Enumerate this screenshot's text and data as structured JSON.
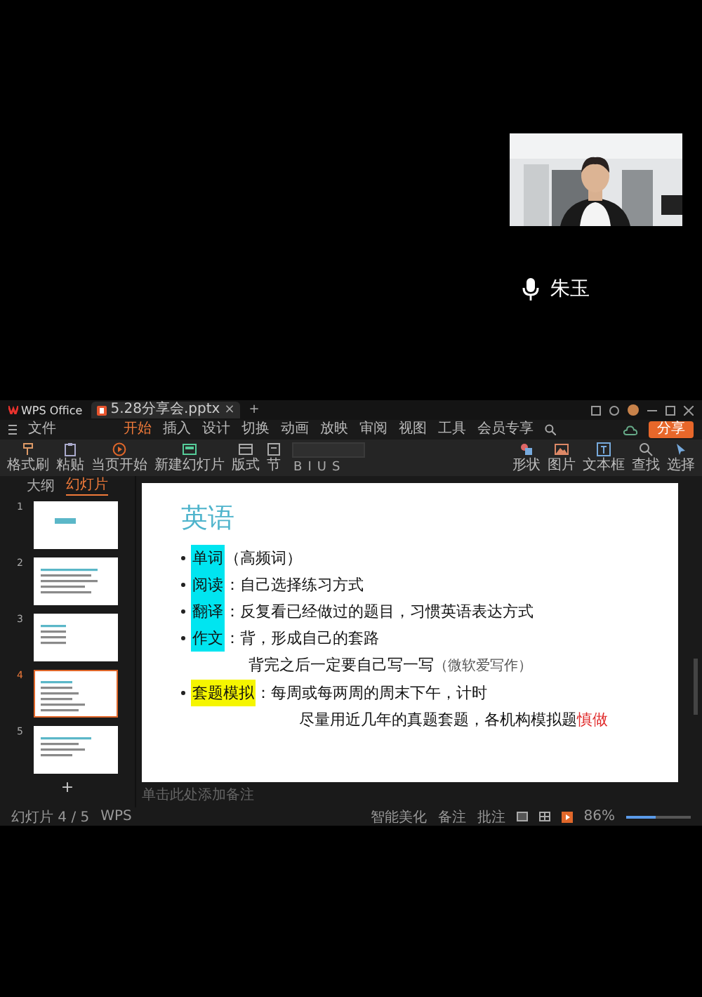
{
  "call": {
    "participant": {
      "name": "朱玉",
      "muted": false
    }
  },
  "window": {
    "app_tab": "WPS Office",
    "file_tab": {
      "title": "5.28分享会.pptx",
      "close": "×"
    },
    "new_tab": "+"
  },
  "menu": {
    "file": "文件",
    "tabs": [
      {
        "label": "开始",
        "selected": true
      },
      {
        "label": "插入",
        "selected": false
      },
      {
        "label": "设计",
        "selected": false
      },
      {
        "label": "切换",
        "selected": false
      },
      {
        "label": "动画",
        "selected": false
      },
      {
        "label": "放映",
        "selected": false
      },
      {
        "label": "审阅",
        "selected": false
      },
      {
        "label": "视图",
        "selected": false
      },
      {
        "label": "工具",
        "selected": false
      },
      {
        "label": "会员专享",
        "selected": false
      }
    ],
    "share": "分享"
  },
  "ribbon": {
    "left": [
      {
        "label": "格式刷"
      },
      {
        "label": "粘贴"
      },
      {
        "label": "当页开始"
      },
      {
        "label": "新建幻灯片"
      },
      {
        "label": "版式"
      },
      {
        "label": "节"
      }
    ],
    "format": [
      "B",
      "I",
      "U",
      "S"
    ],
    "right": [
      {
        "label": "形状"
      },
      {
        "label": "图片"
      },
      {
        "label": "文本框"
      },
      {
        "label": "查找"
      },
      {
        "label": "选择"
      }
    ]
  },
  "panel": {
    "tabs": [
      {
        "label": "大纲",
        "selected": false
      },
      {
        "label": "幻灯片",
        "selected": true
      }
    ],
    "slides": [
      {
        "number": "1",
        "selected": false
      },
      {
        "number": "2",
        "selected": false
      },
      {
        "number": "3",
        "selected": false
      },
      {
        "number": "4",
        "selected": true
      },
      {
        "number": "5",
        "selected": false
      }
    ],
    "add": "+"
  },
  "slide": {
    "title": "英语",
    "bullets": [
      {
        "term": "单词",
        "color": "#00e5f0",
        "text": "（高频词）"
      },
      {
        "term": "阅读",
        "color": "#00e5f0",
        "text": "：自己选择练习方式"
      },
      {
        "term": "翻译",
        "color": "#00e5f0",
        "text": "：反复看已经做过的题目，习惯英语表达方式"
      },
      {
        "term": "作文",
        "color": "#00e5f0",
        "text": "：背，形成自己的套路",
        "sub": [
          [
            {
              "kind": "plain",
              "text": "背完之后一定要自己写一写"
            },
            {
              "kind": "note",
              "text": "（微软爱写作）"
            }
          ]
        ]
      },
      {
        "term": "套题模拟",
        "color": "#f5f500",
        "text": "：每周或每两周的周末下午，计时",
        "sub": [
          [
            {
              "kind": "plain",
              "text": "尽量用近几年的真题套题，各机构模拟题"
            },
            {
              "kind": "warn",
              "text": "慎做"
            }
          ]
        ]
      }
    ]
  },
  "notes": {
    "placeholder": "单击此处添加备注"
  },
  "status_bar": {
    "slide_count": "幻灯片 4 / 5",
    "brand": "WPS",
    "beautify": "智能美化",
    "notes": "备注",
    "comments": "批注",
    "zoom": "86%",
    "zoom_slider": {
      "level": 0.45
    }
  }
}
